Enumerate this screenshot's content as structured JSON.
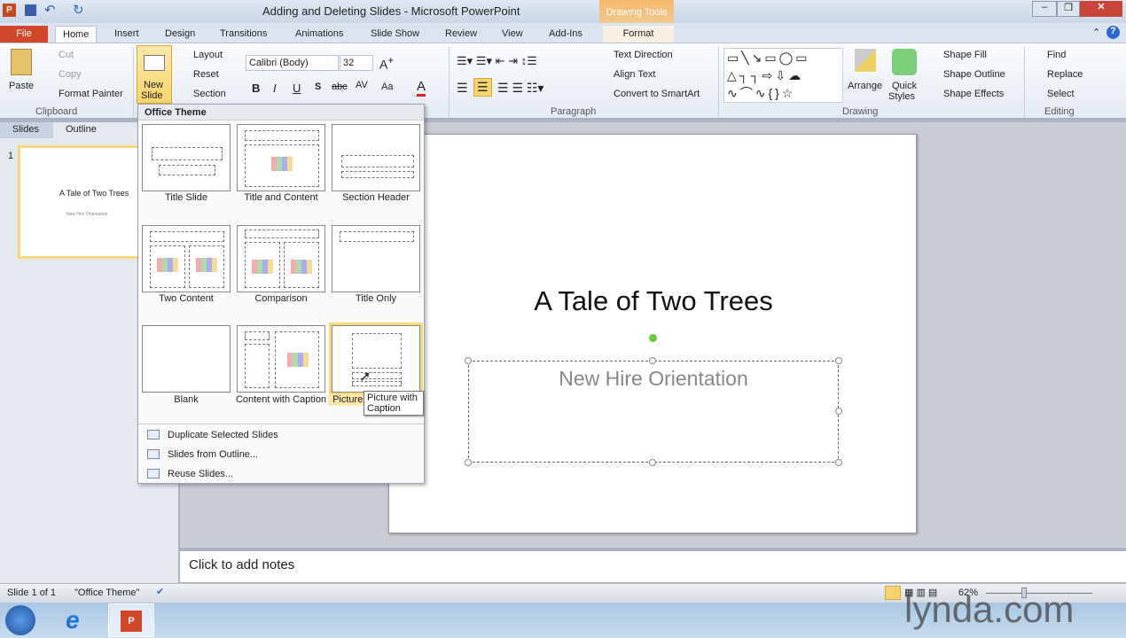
{
  "window": {
    "title": "Adding and Deleting Slides - Microsoft PowerPoint",
    "contextual_tab_group": "Drawing Tools"
  },
  "tabs": [
    "File",
    "Home",
    "Insert",
    "Design",
    "Transitions",
    "Animations",
    "Slide Show",
    "Review",
    "View",
    "Add-Ins",
    "Format"
  ],
  "ribbon": {
    "clipboard": {
      "paste": "Paste",
      "cut": "Cut",
      "copy": "Copy",
      "format_painter": "Format Painter",
      "group": "Clipboard"
    },
    "slides": {
      "new_slide_1": "New",
      "new_slide_2": "Slide",
      "layout": "Layout",
      "reset": "Reset",
      "section": "Section"
    },
    "font": {
      "name": "Calibri (Body)",
      "size": "32",
      "bold": "B",
      "italic": "I",
      "underline": "U",
      "shadow": "S",
      "strike": "abc",
      "spacing": "AV",
      "case": "Aa",
      "color": "A"
    },
    "paragraph": {
      "text_direction": "Text Direction",
      "align_text": "Align Text",
      "convert_smartart": "Convert to SmartArt",
      "group": "Paragraph"
    },
    "drawing": {
      "arrange": "Arrange",
      "quick_styles_1": "Quick",
      "quick_styles_2": "Styles",
      "shape_fill": "Shape Fill",
      "shape_outline": "Shape Outline",
      "shape_effects": "Shape Effects",
      "group": "Drawing"
    },
    "editing": {
      "find": "Find",
      "replace": "Replace",
      "select": "Select",
      "group": "Editing"
    }
  },
  "leftpane": {
    "tabs": [
      "Slides",
      "Outline"
    ],
    "slide_number": "1",
    "thumb_title": "A Tale of Two Trees",
    "thumb_subtitle": "New Hire Orientation"
  },
  "dropdown": {
    "header": "Office Theme",
    "layouts": [
      "Title Slide",
      "Title and Content",
      "Section Header",
      "Two Content",
      "Comparison",
      "Title Only",
      "Blank",
      "Content with Caption",
      "Picture with Caption"
    ],
    "selected": "Picture with Caption",
    "tooltip": "Picture with Caption",
    "menu": [
      "Duplicate Selected Slides",
      "Slides from Outline...",
      "Reuse Slides..."
    ]
  },
  "slide": {
    "title": "A Tale of Two Trees",
    "subtitle": "New Hire Orientation"
  },
  "notes": {
    "placeholder": "Click to add notes"
  },
  "status": {
    "slide": "Slide 1 of 1",
    "theme": "\"Office Theme\"",
    "zoom": "62%"
  },
  "watermark": "lynda.com"
}
